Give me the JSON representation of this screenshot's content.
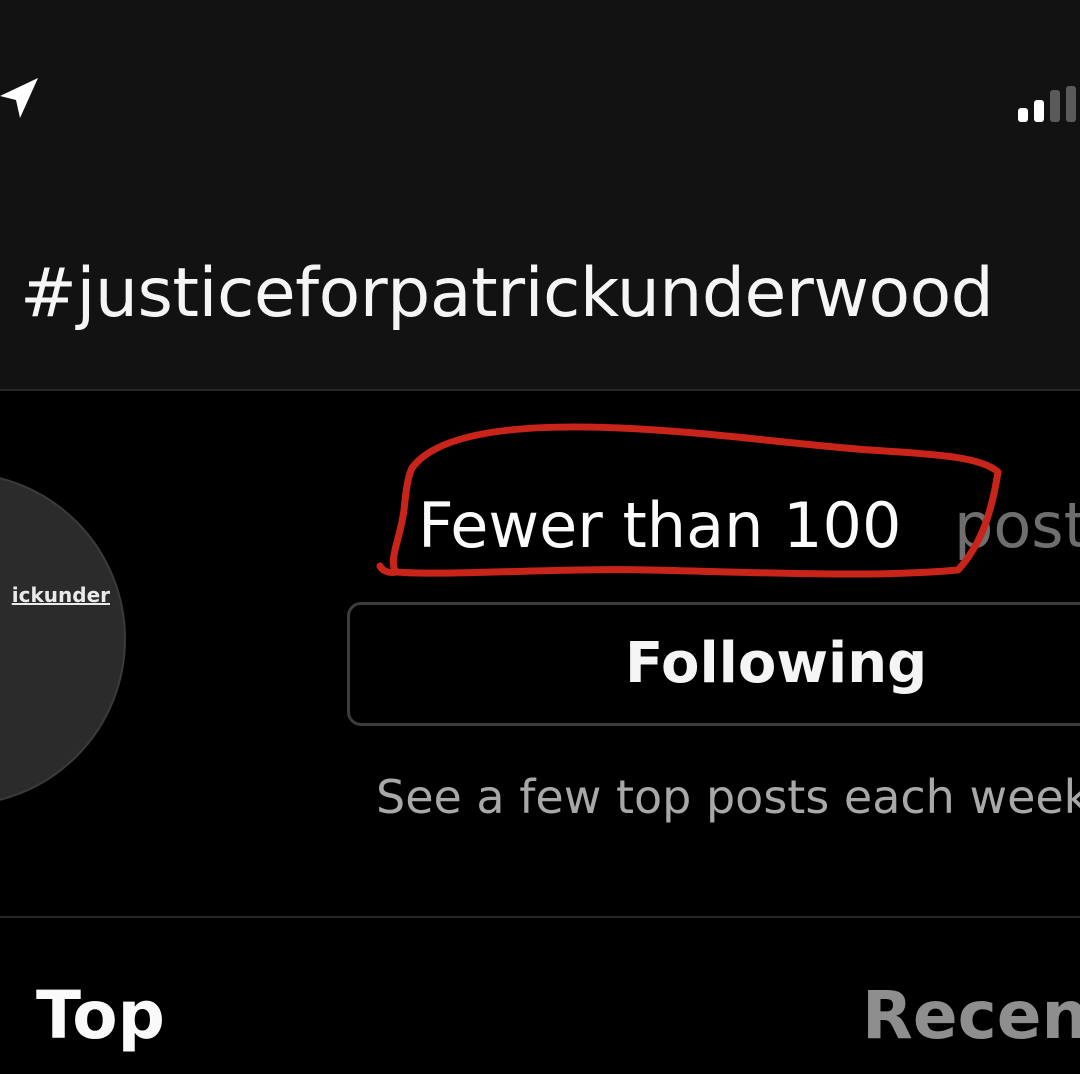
{
  "status_bar": {
    "location_icon": "location-arrow-icon",
    "signal_icon": "cellular-signal-icon"
  },
  "header": {
    "title": "#justiceforpatrickunderwood"
  },
  "profile": {
    "avatar_text": "ickunder",
    "post_count": "Fewer than 100",
    "post_suffix": "posts",
    "follow_button_label": "Following",
    "description": "See a few top posts each week"
  },
  "tabs": [
    {
      "label": "Top",
      "active": true
    },
    {
      "label": "Recent",
      "active": false
    }
  ],
  "colors": {
    "background": "#000000",
    "header_background": "#121212",
    "annotation": "#c8241a",
    "muted_text": "#a8a8a8",
    "inactive_tab": "#8e8e8e"
  }
}
